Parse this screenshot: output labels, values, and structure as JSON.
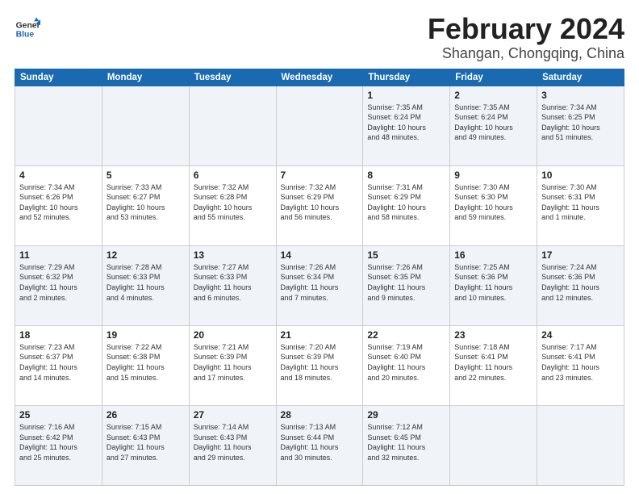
{
  "logo": {
    "line1": "General",
    "line2": "Blue"
  },
  "title": "February 2024",
  "location": "Shangan, Chongqing, China",
  "header": {
    "days": [
      "Sunday",
      "Monday",
      "Tuesday",
      "Wednesday",
      "Thursday",
      "Friday",
      "Saturday"
    ]
  },
  "weeks": [
    [
      {
        "day": "",
        "info": ""
      },
      {
        "day": "",
        "info": ""
      },
      {
        "day": "",
        "info": ""
      },
      {
        "day": "",
        "info": ""
      },
      {
        "day": "1",
        "info": "Sunrise: 7:35 AM\nSunset: 6:24 PM\nDaylight: 10 hours\nand 48 minutes."
      },
      {
        "day": "2",
        "info": "Sunrise: 7:35 AM\nSunset: 6:24 PM\nDaylight: 10 hours\nand 49 minutes."
      },
      {
        "day": "3",
        "info": "Sunrise: 7:34 AM\nSunset: 6:25 PM\nDaylight: 10 hours\nand 51 minutes."
      }
    ],
    [
      {
        "day": "4",
        "info": "Sunrise: 7:34 AM\nSunset: 6:26 PM\nDaylight: 10 hours\nand 52 minutes."
      },
      {
        "day": "5",
        "info": "Sunrise: 7:33 AM\nSunset: 6:27 PM\nDaylight: 10 hours\nand 53 minutes."
      },
      {
        "day": "6",
        "info": "Sunrise: 7:32 AM\nSunset: 6:28 PM\nDaylight: 10 hours\nand 55 minutes."
      },
      {
        "day": "7",
        "info": "Sunrise: 7:32 AM\nSunset: 6:29 PM\nDaylight: 10 hours\nand 56 minutes."
      },
      {
        "day": "8",
        "info": "Sunrise: 7:31 AM\nSunset: 6:29 PM\nDaylight: 10 hours\nand 58 minutes."
      },
      {
        "day": "9",
        "info": "Sunrise: 7:30 AM\nSunset: 6:30 PM\nDaylight: 10 hours\nand 59 minutes."
      },
      {
        "day": "10",
        "info": "Sunrise: 7:30 AM\nSunset: 6:31 PM\nDaylight: 11 hours\nand 1 minute."
      }
    ],
    [
      {
        "day": "11",
        "info": "Sunrise: 7:29 AM\nSunset: 6:32 PM\nDaylight: 11 hours\nand 2 minutes."
      },
      {
        "day": "12",
        "info": "Sunrise: 7:28 AM\nSunset: 6:33 PM\nDaylight: 11 hours\nand 4 minutes."
      },
      {
        "day": "13",
        "info": "Sunrise: 7:27 AM\nSunset: 6:33 PM\nDaylight: 11 hours\nand 6 minutes."
      },
      {
        "day": "14",
        "info": "Sunrise: 7:26 AM\nSunset: 6:34 PM\nDaylight: 11 hours\nand 7 minutes."
      },
      {
        "day": "15",
        "info": "Sunrise: 7:26 AM\nSunset: 6:35 PM\nDaylight: 11 hours\nand 9 minutes."
      },
      {
        "day": "16",
        "info": "Sunrise: 7:25 AM\nSunset: 6:36 PM\nDaylight: 11 hours\nand 10 minutes."
      },
      {
        "day": "17",
        "info": "Sunrise: 7:24 AM\nSunset: 6:36 PM\nDaylight: 11 hours\nand 12 minutes."
      }
    ],
    [
      {
        "day": "18",
        "info": "Sunrise: 7:23 AM\nSunset: 6:37 PM\nDaylight: 11 hours\nand 14 minutes."
      },
      {
        "day": "19",
        "info": "Sunrise: 7:22 AM\nSunset: 6:38 PM\nDaylight: 11 hours\nand 15 minutes."
      },
      {
        "day": "20",
        "info": "Sunrise: 7:21 AM\nSunset: 6:39 PM\nDaylight: 11 hours\nand 17 minutes."
      },
      {
        "day": "21",
        "info": "Sunrise: 7:20 AM\nSunset: 6:39 PM\nDaylight: 11 hours\nand 18 minutes."
      },
      {
        "day": "22",
        "info": "Sunrise: 7:19 AM\nSunset: 6:40 PM\nDaylight: 11 hours\nand 20 minutes."
      },
      {
        "day": "23",
        "info": "Sunrise: 7:18 AM\nSunset: 6:41 PM\nDaylight: 11 hours\nand 22 minutes."
      },
      {
        "day": "24",
        "info": "Sunrise: 7:17 AM\nSunset: 6:41 PM\nDaylight: 11 hours\nand 23 minutes."
      }
    ],
    [
      {
        "day": "25",
        "info": "Sunrise: 7:16 AM\nSunset: 6:42 PM\nDaylight: 11 hours\nand 25 minutes."
      },
      {
        "day": "26",
        "info": "Sunrise: 7:15 AM\nSunset: 6:43 PM\nDaylight: 11 hours\nand 27 minutes."
      },
      {
        "day": "27",
        "info": "Sunrise: 7:14 AM\nSunset: 6:43 PM\nDaylight: 11 hours\nand 29 minutes."
      },
      {
        "day": "28",
        "info": "Sunrise: 7:13 AM\nSunset: 6:44 PM\nDaylight: 11 hours\nand 30 minutes."
      },
      {
        "day": "29",
        "info": "Sunrise: 7:12 AM\nSunset: 6:45 PM\nDaylight: 11 hours\nand 32 minutes."
      },
      {
        "day": "",
        "info": ""
      },
      {
        "day": "",
        "info": ""
      }
    ]
  ]
}
